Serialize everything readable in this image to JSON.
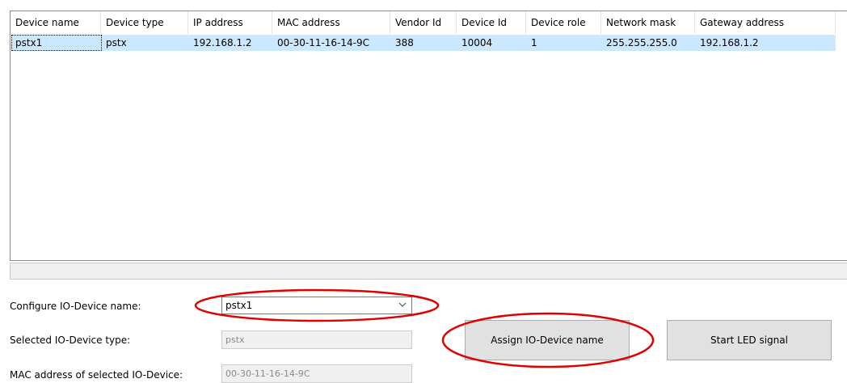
{
  "device_list": {
    "columns": [
      "Device name",
      "Device type",
      "IP address",
      "MAC address",
      "Vendor Id",
      "Device Id",
      "Device role",
      "Network mask",
      "Gateway address"
    ],
    "rows": [
      [
        "pstx1",
        "pstx",
        "192.168.1.2",
        "00-30-11-16-14-9C",
        "388",
        "10004",
        "1",
        "255.255.255.0",
        "192.168.1.2"
      ]
    ]
  },
  "form": {
    "configure_name_label": "Configure IO-Device name:",
    "configure_name_value": "pstx1",
    "device_type_label": "Selected IO-Device type:",
    "device_type_value": "pstx",
    "mac_label": "MAC address of selected IO-Device:",
    "mac_value": "00-30-11-16-14-9C"
  },
  "buttons": {
    "assign_label": "Assign IO-Device name",
    "led_label": "Start LED signal"
  },
  "colors": {
    "selection": "#cce8ff",
    "annotation": "#e00000"
  }
}
